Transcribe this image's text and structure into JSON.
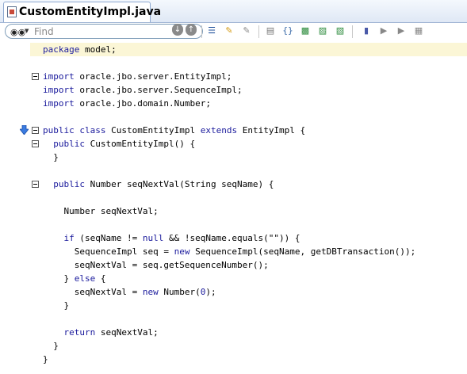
{
  "tab": {
    "title": "CustomEntityImpl.java"
  },
  "find": {
    "placeholder": "Find"
  },
  "toolbar": {
    "icons": [
      "find-previous-icon",
      "find-next-icon",
      "highlight-icon",
      "clear-highlights-icon",
      "toggle-comment-icon",
      "surround-with-icon",
      "code-template-icon",
      "refactor-icon",
      "quick-outline-icon",
      "toggle-bookmark-icon",
      "next-bookmark-icon",
      "previous-bookmark-icon",
      "bookmarks-list-icon"
    ]
  },
  "code": {
    "lines": [
      {
        "t": [
          [
            "kw",
            "package"
          ],
          [
            "",
            " model;"
          ]
        ]
      },
      {
        "t": []
      },
      {
        "t": [
          [
            "kw",
            "import"
          ],
          [
            "",
            " oracle.jbo.server.EntityImpl;"
          ]
        ]
      },
      {
        "t": [
          [
            "kw",
            "import"
          ],
          [
            "",
            " oracle.jbo.server.SequenceImpl;"
          ]
        ]
      },
      {
        "t": [
          [
            "kw",
            "import"
          ],
          [
            "",
            " oracle.jbo.domain.Number;"
          ]
        ]
      },
      {
        "t": []
      },
      {
        "t": [
          [
            "kw",
            "public"
          ],
          [
            "",
            " "
          ],
          [
            "kw",
            "class"
          ],
          [
            "",
            " CustomEntityImpl "
          ],
          [
            "kw",
            "extends"
          ],
          [
            "",
            " EntityImpl {"
          ]
        ]
      },
      {
        "t": [
          [
            "",
            "  "
          ],
          [
            "kw",
            "public"
          ],
          [
            "",
            " CustomEntityImpl() {"
          ]
        ]
      },
      {
        "t": [
          [
            "",
            "  }"
          ]
        ]
      },
      {
        "t": []
      },
      {
        "t": [
          [
            "",
            "  "
          ],
          [
            "kw",
            "public"
          ],
          [
            "",
            " Number seqNextVal(String seqName) {"
          ]
        ]
      },
      {
        "t": []
      },
      {
        "t": [
          [
            "",
            "    Number seqNextVal;"
          ]
        ]
      },
      {
        "t": []
      },
      {
        "t": [
          [
            "",
            "    "
          ],
          [
            "kw",
            "if"
          ],
          [
            "",
            " (seqName != "
          ],
          [
            "kw",
            "null"
          ],
          [
            "",
            " && !seqName.equals(\"\")) {"
          ]
        ]
      },
      {
        "t": [
          [
            "",
            "      SequenceImpl seq = "
          ],
          [
            "kw",
            "new"
          ],
          [
            "",
            " SequenceImpl(seqName, getDBTransaction());"
          ]
        ]
      },
      {
        "t": [
          [
            "",
            "      seqNextVal = seq.getSequenceNumber();"
          ]
        ]
      },
      {
        "t": [
          [
            "",
            "    } "
          ],
          [
            "kw",
            "else"
          ],
          [
            "",
            " {"
          ]
        ]
      },
      {
        "t": [
          [
            "",
            "      seqNextVal = "
          ],
          [
            "kw",
            "new"
          ],
          [
            "",
            " Number("
          ],
          [
            "lit",
            "0"
          ],
          [
            "",
            ");"
          ]
        ]
      },
      {
        "t": [
          [
            "",
            "    }"
          ]
        ]
      },
      {
        "t": []
      },
      {
        "t": [
          [
            "",
            "    "
          ],
          [
            "kw",
            "return"
          ],
          [
            "",
            " seqNextVal;"
          ]
        ]
      },
      {
        "t": [
          [
            "",
            "  }"
          ]
        ]
      },
      {
        "t": [
          [
            "",
            "}"
          ]
        ]
      }
    ],
    "folds": [
      2,
      6,
      7,
      10
    ],
    "implements_marker_line": 6,
    "current_line": 0
  },
  "colors": {
    "keyword": "#1a1a9c",
    "current_line": "#fbf6d6",
    "tab_border": "#8ea9d0"
  }
}
